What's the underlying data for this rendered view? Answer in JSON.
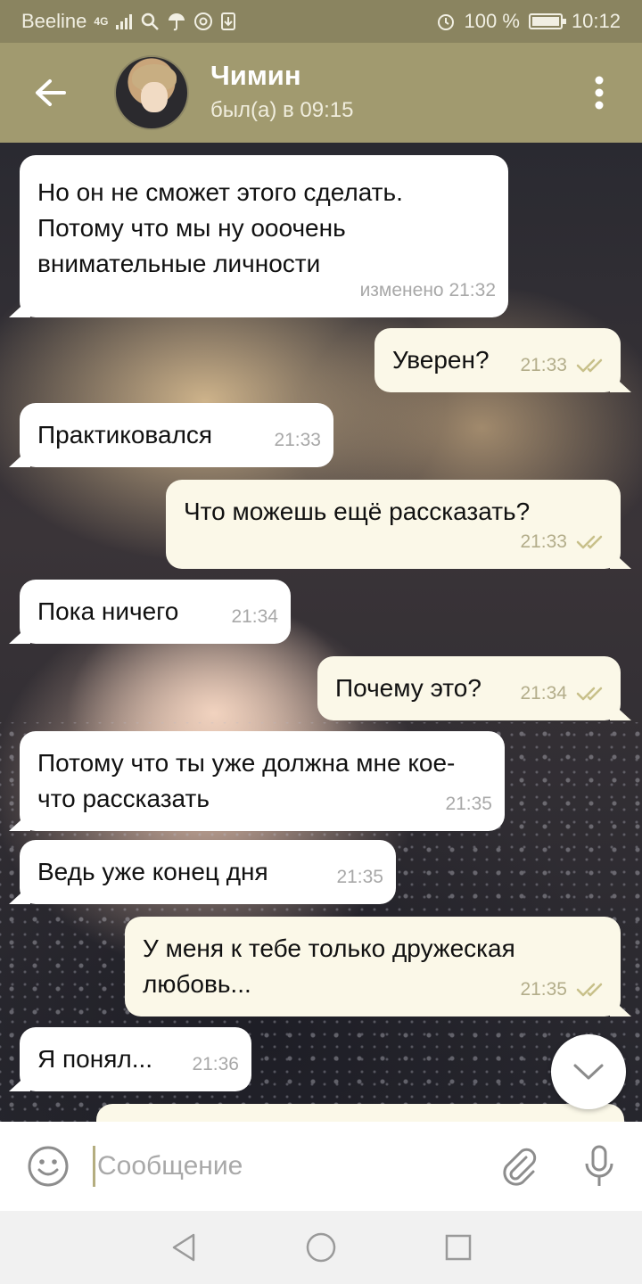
{
  "status_bar": {
    "carrier": "Beeline",
    "network": "4G",
    "battery_text": "100 %",
    "time": "10:12",
    "battery_level": 1.0
  },
  "header": {
    "name": "Чимин",
    "status": "был(а) в 09:15"
  },
  "messages": [
    {
      "dir": "in",
      "text": "Но он не сможет этого сделать. Потому что мы ну ооочень внимательные личности",
      "time": "изменено 21:32"
    },
    {
      "dir": "out",
      "text": "Уверен?",
      "time": "21:33"
    },
    {
      "dir": "in",
      "text": "Практиковался",
      "time": "21:33"
    },
    {
      "dir": "out",
      "text": "Что можешь ещё рассказать?",
      "time": "21:33"
    },
    {
      "dir": "in",
      "text": "Пока ничего",
      "time": "21:34"
    },
    {
      "dir": "out",
      "text": "Почему это?",
      "time": "21:34"
    },
    {
      "dir": "in",
      "text": "Потому что ты уже должна мне кое-что рассказать",
      "time": "21:35"
    },
    {
      "dir": "in",
      "text": "Ведь уже конец дня",
      "time": "21:35"
    },
    {
      "dir": "out",
      "text": "У меня к тебе только дружеская любовь...",
      "time": "21:35"
    },
    {
      "dir": "in",
      "text": "Я понял...",
      "time": "21:36"
    }
  ],
  "composer": {
    "placeholder": "Сообщение"
  },
  "colors": {
    "header": "#a19a6f",
    "status_bar": "#8a8460",
    "outgoing_bubble": "#fbf8e8",
    "incoming_bubble": "#ffffff",
    "check_marks": "#c8c08a"
  },
  "icons": [
    "back-arrow-icon",
    "more-vertical-icon",
    "emoji-icon",
    "attach-icon",
    "mic-icon",
    "chevron-down-icon",
    "nav-back-icon",
    "nav-home-icon",
    "nav-recents-icon"
  ]
}
